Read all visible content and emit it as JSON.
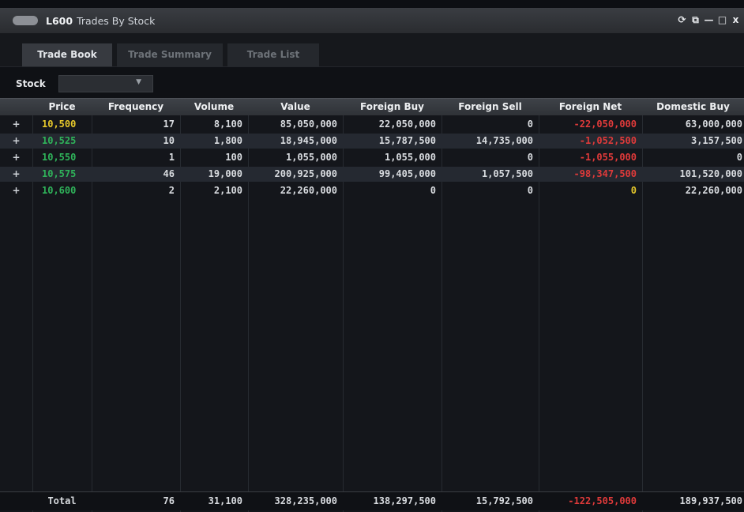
{
  "window": {
    "code": "L600",
    "title": "Trades By Stock",
    "controls": [
      "⟳",
      "⧉",
      "—",
      "□",
      "x"
    ]
  },
  "tabs": [
    {
      "label": "Trade Book",
      "active": true
    },
    {
      "label": "Trade Summary",
      "active": false
    },
    {
      "label": "Trade List",
      "active": false
    }
  ],
  "stock": {
    "label": "Stock",
    "value": "",
    "caret": "▼"
  },
  "columns": [
    "Price",
    "Frequency",
    "Volume",
    "Value",
    "Foreign Buy",
    "Foreign Sell",
    "Foreign Net",
    "Domestic Buy"
  ],
  "rows": [
    {
      "expand": "+",
      "price": "10,500",
      "frequency": "17",
      "volume": "8,100",
      "value": "85,050,000",
      "foreign_buy": "22,050,000",
      "foreign_sell": "0",
      "foreign_net": "-22,050,000",
      "domestic_buy": "63,000,000"
    },
    {
      "expand": "+",
      "price": "10,525",
      "frequency": "10",
      "volume": "1,800",
      "value": "18,945,000",
      "foreign_buy": "15,787,500",
      "foreign_sell": "14,735,000",
      "foreign_net": "-1,052,500",
      "domestic_buy": "3,157,500"
    },
    {
      "expand": "+",
      "price": "10,550",
      "frequency": "1",
      "volume": "100",
      "value": "1,055,000",
      "foreign_buy": "1,055,000",
      "foreign_sell": "0",
      "foreign_net": "-1,055,000",
      "domestic_buy": "0"
    },
    {
      "expand": "+",
      "price": "10,575",
      "frequency": "46",
      "volume": "19,000",
      "value": "200,925,000",
      "foreign_buy": "99,405,000",
      "foreign_sell": "1,057,500",
      "foreign_net": "-98,347,500",
      "domestic_buy": "101,520,000"
    },
    {
      "expand": "+",
      "price": "10,600",
      "frequency": "2",
      "volume": "2,100",
      "value": "22,260,000",
      "foreign_buy": "0",
      "foreign_sell": "0",
      "foreign_net": "0",
      "domestic_buy": "22,260,000"
    }
  ],
  "total": {
    "label": "Total",
    "frequency": "76",
    "volume": "31,100",
    "value": "328,235,000",
    "foreign_buy": "138,297,500",
    "foreign_sell": "15,792,500",
    "foreign_net": "-122,505,000",
    "domestic_buy": "189,937,500"
  },
  "colors": {
    "price_unchanged": "#e5c72b",
    "price_up": "#2fb35a",
    "negative": "#e03a3a"
  }
}
